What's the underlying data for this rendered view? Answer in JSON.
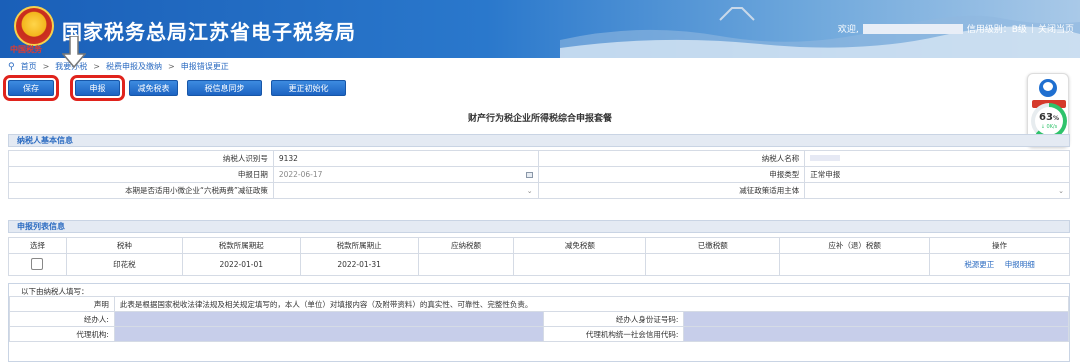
{
  "header": {
    "logo_text": "中国税务",
    "site_title": "国家税务总局江苏省电子税务局",
    "welcome": "欢迎,",
    "credit_level": "信用级别：B级",
    "separator": "|",
    "close_page": "关闭当页"
  },
  "breadcrumb": [
    {
      "label": "首页"
    },
    {
      "label": "我要办税"
    },
    {
      "label": "税费申报及缴纳"
    },
    {
      "label": "申报错误更正"
    }
  ],
  "breadcrumb_sep": ">",
  "toolbar": {
    "save": "保存",
    "declare": "申报",
    "tax_reduction": "减免税表",
    "sync": "税信息同步",
    "correct_init": "更正初始化"
  },
  "support": {
    "gauge_value": 63,
    "gauge_unit": "%",
    "speed": "↓ 0K/s"
  },
  "page_title": "财产行为税企业所得税综合申报套餐",
  "basic_info": {
    "section_title": "纳税人基本信息",
    "taxpayer_id_label": "纳税人识别号",
    "taxpayer_id_value": "9132",
    "taxpayer_name_label": "纳税人名称",
    "declare_date_label": "申报日期",
    "declare_date_value": "2022-06-17",
    "declare_type_label": "申报类型",
    "declare_type_value": "正常申报",
    "policy_label": "本期是否适用小微企业“六税两费”减征政策",
    "policy_subject_label": "减征政策适用主体"
  },
  "declare_list": {
    "section_title": "申报列表信息",
    "columns": [
      "选择",
      "税种",
      "税款所属期起",
      "税款所属期止",
      "应纳税额",
      "减免税额",
      "已缴税额",
      "应补（退）税额",
      "操作"
    ],
    "rows": [
      {
        "tax_type": "印花税",
        "period_start": "2022-01-01",
        "period_end": "2022-01-31",
        "payable": "",
        "reduction": "",
        "paid": "",
        "refund": "",
        "action_correct": "税源更正",
        "action_detail": "申报明细"
      }
    ]
  },
  "declaration": {
    "note": "以下由纳税人填写：",
    "statement_label": "声明",
    "statement_text": "此表是根据国家税收法律法规及相关规定填写的，本人（单位）对填报内容（及附带资料）的真实性、可靠性、完整性负责。",
    "agent_label": "经办人:",
    "agent_id_label": "经办人身份证号码:",
    "agency_label": "代理机构:",
    "agency_code_label": "代理机构统一社会信用代码:"
  },
  "colors": {
    "brand_blue": "#1f6fd0",
    "highlight_red": "#e0231c",
    "section_bg": "#e4eaf3",
    "filled_bg": "#c7ceea"
  }
}
